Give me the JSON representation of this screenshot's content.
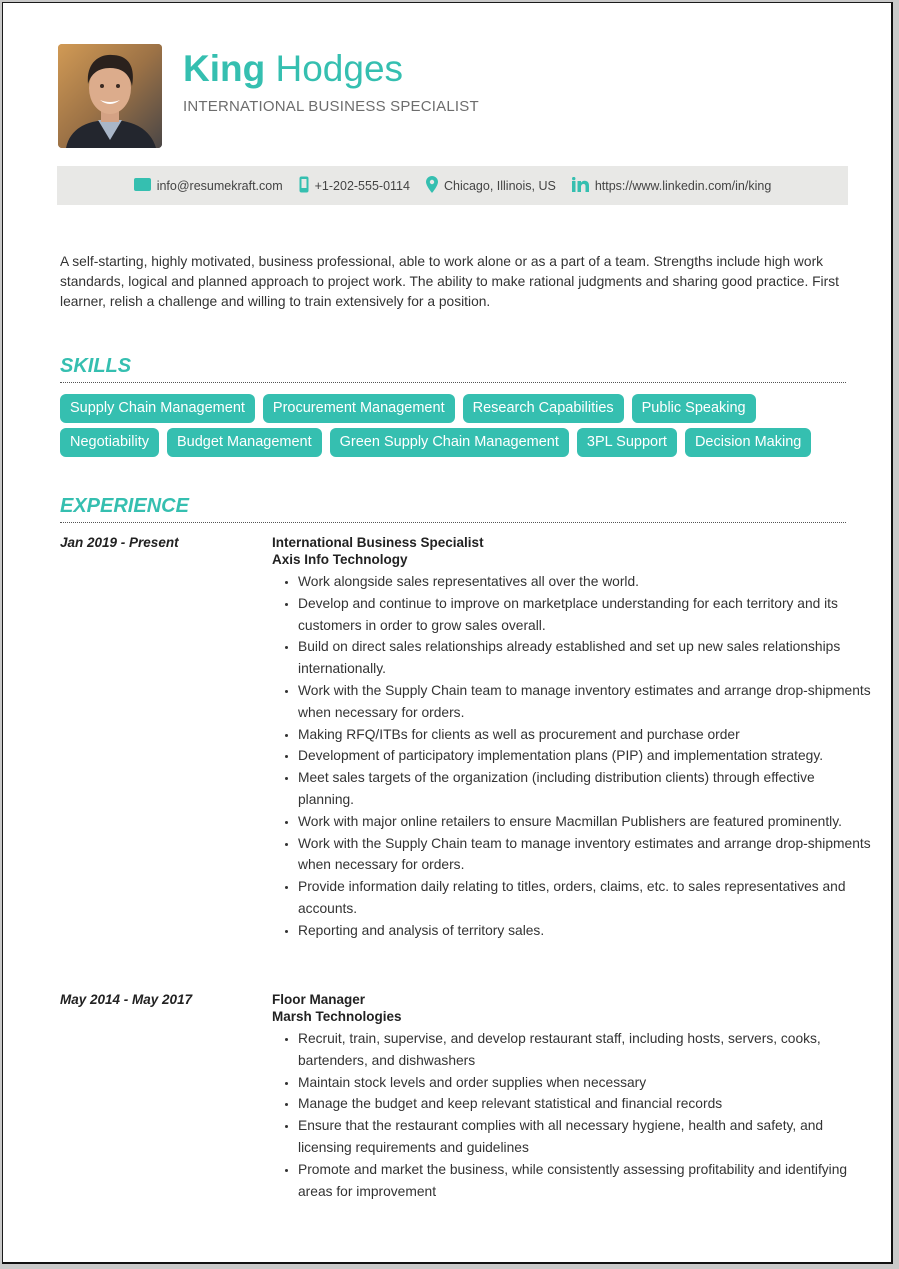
{
  "header": {
    "first_name": "King",
    "last_name": "Hodges",
    "title": "INTERNATIONAL BUSINESS SPECIALIST",
    "photo_alt": "Profile photo of King Hodges"
  },
  "contact": {
    "email": {
      "icon": "email-icon",
      "text": "info@resumekraft.com"
    },
    "phone": {
      "icon": "phone-icon",
      "text": "+1-202-555-0114"
    },
    "location": {
      "icon": "location-pin-icon",
      "text": "Chicago, Illinois, US"
    },
    "linkedin": {
      "icon": "linkedin-icon",
      "text": "https://www.linkedin.com/in/king"
    }
  },
  "summary": "A self-starting, highly motivated, business professional, able to work alone or as a part of a team. Strengths include high work standards, logical and planned approach to project work. The ability to make rational judgments and sharing good practice. First learner, relish a challenge and willing to train extensively for a position.",
  "skills": {
    "heading": "SKILLS",
    "items": [
      "Supply Chain Management",
      "Procurement Management",
      "Research Capabilities",
      "Public Speaking",
      "Negotiability",
      "Budget Management",
      "Green Supply Chain Management",
      "3PL Support",
      "Decision Making"
    ]
  },
  "experience": {
    "heading": "EXPERIENCE",
    "jobs": [
      {
        "dates": "Jan 2019 - Present",
        "role": "International Business Specialist",
        "company": "Axis Info Technology",
        "bullets": [
          "Work alongside sales representatives all over the world.",
          "Develop and continue to improve on marketplace understanding for each territory and its customers in order to grow sales overall.",
          "Build on direct sales relationships already established and set up new sales relationships internationally.",
          "Work with the Supply Chain team to manage inventory estimates and arrange drop-shipments when necessary for orders.",
          "Making RFQ/ITBs for clients as well as procurement and purchase order",
          "Development of participatory implementation plans (PIP) and implementation strategy.",
          "Meet sales targets of the organization (including distribution clients) through effective planning.",
          "Work with major online retailers to ensure Macmillan Publishers are featured prominently.",
          "Work with the Supply Chain team to manage inventory estimates and arrange drop-shipments when necessary for orders.",
          "Provide information daily relating to titles, orders, claims, etc. to sales representatives and accounts.",
          "Reporting and analysis of territory sales."
        ]
      },
      {
        "dates": "May 2014 - May 2017",
        "role": "Floor Manager",
        "company": "Marsh Technologies",
        "bullets": [
          "Recruit, train, supervise, and develop restaurant staff, including hosts, servers, cooks, bartenders, and dishwashers",
          "Maintain stock levels and order supplies when necessary",
          "Manage the budget and keep relevant statistical and financial records",
          "Ensure that the restaurant complies with all necessary hygiene, health and safety, and licensing requirements and guidelines",
          "Promote and market the business, while consistently assessing profitability and identifying areas for improvement"
        ]
      }
    ]
  },
  "colors": {
    "accent": "#35bfb0",
    "contact_bar_bg": "#e8e8e6",
    "title_gray": "#6d6d6d",
    "body_text": "#333333"
  }
}
